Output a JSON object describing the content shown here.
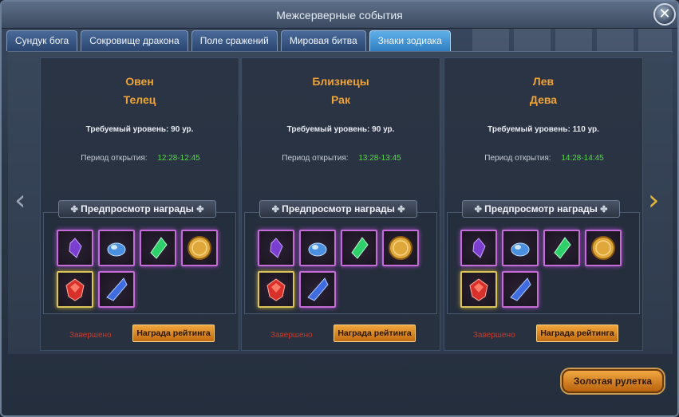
{
  "window": {
    "title": "Межсерверные события",
    "close_glyph": "✕"
  },
  "tabs": [
    {
      "label": "Сундук бога"
    },
    {
      "label": "Сокровище дракона"
    },
    {
      "label": "Поле сражений"
    },
    {
      "label": "Мировая битва"
    },
    {
      "label": "Знаки зодиака",
      "active": true
    }
  ],
  "nav": {
    "prev_glyph": "‹",
    "next_glyph": "›"
  },
  "cards": [
    {
      "sign1": "Овен",
      "sign2": "Телец",
      "required_level": "Требуемый уровень: 90 ур.",
      "period_label": "Период открытия:",
      "period_time": "12:28-12:45",
      "reward_header": "Предпросмотр награды",
      "status": "Завершено",
      "rank_button": "Награда рейтинга"
    },
    {
      "sign1": "Близнецы",
      "sign2": "Рак",
      "required_level": "Требуемый уровень: 90 ур.",
      "period_label": "Период открытия:",
      "period_time": "13:28-13:45",
      "reward_header": "Предпросмотр награды",
      "status": "Завершено",
      "rank_button": "Награда рейтинга"
    },
    {
      "sign1": "Лев",
      "sign2": "Дева",
      "required_level": "Требуемый уровень: 110 ур.",
      "period_label": "Период открытия:",
      "period_time": "14:28-14:45",
      "reward_header": "Предпросмотр награды",
      "status": "Завершено",
      "rank_button": "Награда рейтинга"
    }
  ],
  "reward_items": [
    {
      "icon": "purple-crystal-icon",
      "frame": "purple",
      "color": "#7a3fd0"
    },
    {
      "icon": "blue-ore-icon",
      "frame": "purple",
      "color": "#4a8fe0"
    },
    {
      "icon": "green-crystal-icon",
      "frame": "purple",
      "color": "#2fcf6a"
    },
    {
      "icon": "gold-coin-icon",
      "frame": "purple",
      "color": "#e0a83a"
    },
    {
      "icon": "red-gem-icon",
      "frame": "gold",
      "color": "#d8302a"
    },
    {
      "icon": "blue-shard-icon",
      "frame": "purple",
      "color": "#3f6ce0"
    }
  ],
  "footer": {
    "roulette_button": "Золотая рулетка"
  },
  "colors": {
    "accent_orange": "#f0a335",
    "time_green": "#59d84a",
    "status_red": "#c93b2c",
    "active_tab": "#4a9fd8"
  }
}
